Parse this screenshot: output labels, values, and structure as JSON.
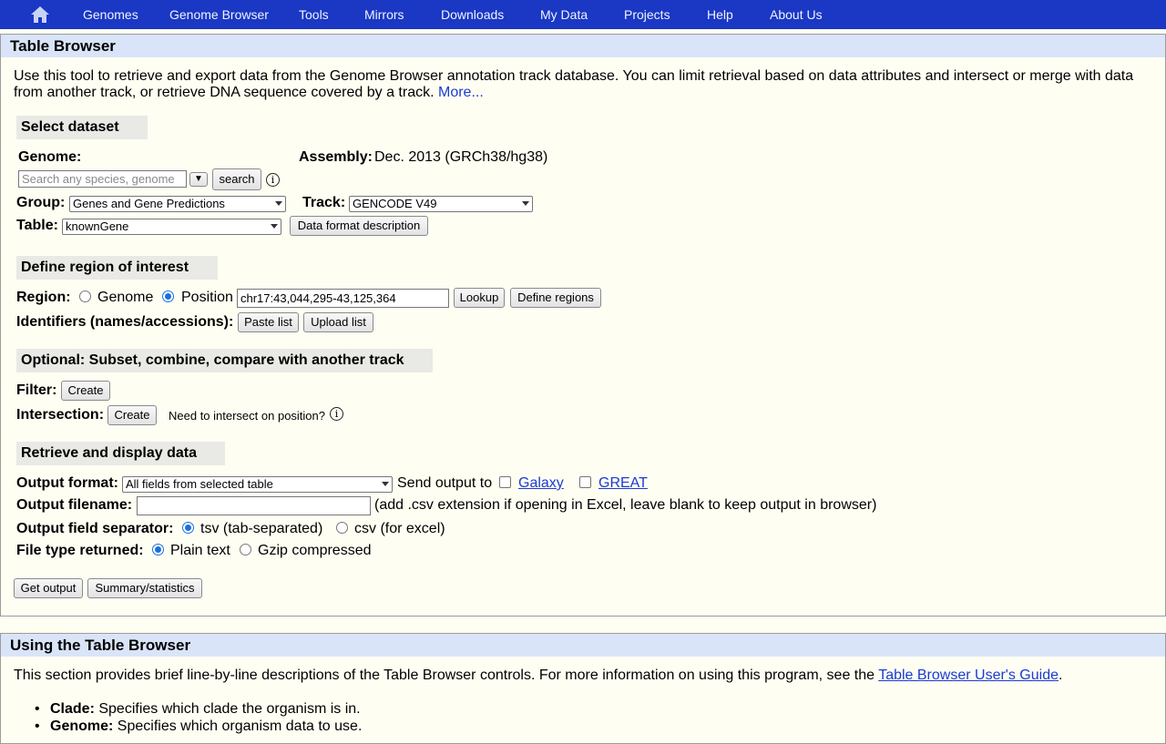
{
  "nav": {
    "home_icon": "house-icon",
    "items": [
      "Genomes",
      "Genome Browser",
      "Tools",
      "Mirrors",
      "Downloads",
      "My Data",
      "Projects",
      "Help",
      "About Us"
    ]
  },
  "panel1": {
    "title": "Table Browser",
    "intro": "Use this tool to retrieve and export data from the Genome Browser annotation track database. You can limit retrieval based on data attributes and intersect or merge with data from another track, or retrieve DNA sequence covered by a track.",
    "more_link": "More..."
  },
  "select_dataset": {
    "heading": "Select dataset",
    "genome_label": "Genome:",
    "genome_placeholder": "Search any species, genome or assembly name",
    "search_button": "search",
    "info_icon": "info-icon",
    "assembly_label": "Assembly:",
    "assembly_value": "Dec. 2013 (GRCh38/hg38)",
    "group_label": "Group:",
    "group_value": "Genes and Gene Predictions",
    "track_label": "Track:",
    "track_value": "GENCODE V49",
    "table_label": "Table:",
    "table_value": "knownGene",
    "data_format_button": "Data format description"
  },
  "region": {
    "heading": "Define region of interest",
    "region_label": "Region:",
    "genome_option": "Genome",
    "position_option": "Position",
    "selected": "Position",
    "position_value": "chr17:43,044,295-43,125,364",
    "lookup_button": "Lookup",
    "define_regions_button": "Define regions",
    "identifiers_label": "Identifiers (names/accessions):",
    "paste_list_button": "Paste list",
    "upload_list_button": "Upload list"
  },
  "optional": {
    "heading": "Optional: Subset, combine, compare with another track",
    "filter_label": "Filter:",
    "filter_button": "Create",
    "intersection_label": "Intersection:",
    "intersection_button": "Create",
    "intersect_note": "Need to intersect on position?"
  },
  "retrieve": {
    "heading": "Retrieve and display data",
    "output_format_label": "Output format:",
    "output_format_value": "All fields from selected table",
    "send_output_label": "Send output to",
    "galaxy_link": "Galaxy",
    "great_link": "GREAT",
    "output_filename_label": "Output filename:",
    "output_filename_value": "",
    "filename_note": "(add .csv extension if opening in Excel, leave blank to keep output in browser)",
    "separator_label": "Output field separator:",
    "tsv_option": "tsv (tab-separated)",
    "csv_option": "csv (for excel)",
    "separator_selected": "tsv",
    "file_type_label": "File type returned:",
    "plain_option": "Plain text",
    "gzip_option": "Gzip compressed",
    "file_type_selected": "Plain text",
    "get_output_button": "Get output",
    "summary_button": "Summary/statistics"
  },
  "panel2": {
    "title": "Using the Table Browser",
    "intro_text": "This section provides brief line-by-line descriptions of the Table Browser controls. For more information on using this program, see the",
    "guide_link": "Table Browser User's Guide",
    "period": ".",
    "items": [
      {
        "term": "Clade:",
        "desc": "Specifies which clade the organism is in."
      },
      {
        "term": "Genome:",
        "desc": "Specifies which organism data to use."
      }
    ]
  },
  "colors": {
    "nav_bg": "#1a38c4",
    "panel_title_bg": "#d9e4f8",
    "page_bg": "#fffef3",
    "link": "#1a3bd4"
  }
}
